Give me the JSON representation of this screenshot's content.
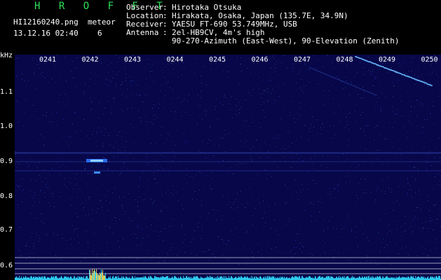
{
  "header": {
    "app": "H R O F F T",
    "file": "HI12160240.png",
    "datetime": "13.12.16 02:40",
    "meteor_label": "meteor",
    "meteor_count": "6",
    "observer_label": "Observer",
    "observer": "Hirotaka Otsuka",
    "location_label": "Location",
    "location": "Hirakata, Osaka, Japan (135.7E, 34.9N)",
    "receiver_label": "Receiver",
    "receiver": "YAESU FT-690 53.749MHz, USB",
    "antenna_label": "Antenna",
    "antenna_line1": "2el-HB9CV, 4m's high",
    "antenna_line2": "90-270-Azimuth (East-West), 90-Elevation (Zenith)"
  },
  "axis": {
    "unit": "kHz",
    "y_ticks": [
      "1.1",
      "1.0",
      "0.9",
      "0.8",
      "0.7",
      "0.6"
    ],
    "x_ticks": [
      "0241",
      "0242",
      "0243",
      "0244",
      "0245",
      "0246",
      "0247",
      "0248",
      "0249",
      "0250"
    ]
  },
  "colors": {
    "background": "#000000",
    "plot_background": "#07074a",
    "header_accent": "#2ee25a",
    "signal": "#6ab8ff",
    "noise_band": "#33e0ff"
  }
}
